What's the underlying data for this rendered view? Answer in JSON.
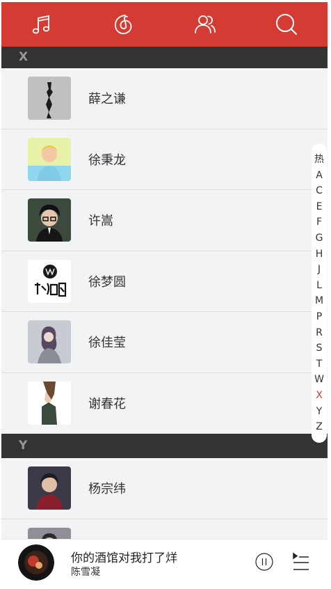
{
  "tabs": [
    {
      "name": "music-note-icon"
    },
    {
      "name": "radio-icon"
    },
    {
      "name": "friends-icon"
    },
    {
      "name": "search-icon"
    }
  ],
  "sections": [
    {
      "letter": "X",
      "artists": [
        {
          "name": "薛之谦"
        },
        {
          "name": "徐秉龙"
        },
        {
          "name": "许嵩"
        },
        {
          "name": "徐梦圆"
        },
        {
          "name": "徐佳莹"
        },
        {
          "name": "谢春花"
        }
      ]
    },
    {
      "letter": "Y",
      "artists": [
        {
          "name": "杨宗纬"
        }
      ]
    }
  ],
  "index_letters": [
    "热",
    "A",
    "C",
    "E",
    "F",
    "G",
    "H",
    "J",
    "L",
    "M",
    "P",
    "R",
    "S",
    "T",
    "W",
    "X",
    "Y",
    "Z"
  ],
  "active_index": "X",
  "player": {
    "song": "你的酒馆对我打了烊",
    "singer": "陈雪凝"
  },
  "colors": {
    "brand": "#d43c33",
    "section_bg": "#333333",
    "list_bg": "#f2f3f5"
  }
}
